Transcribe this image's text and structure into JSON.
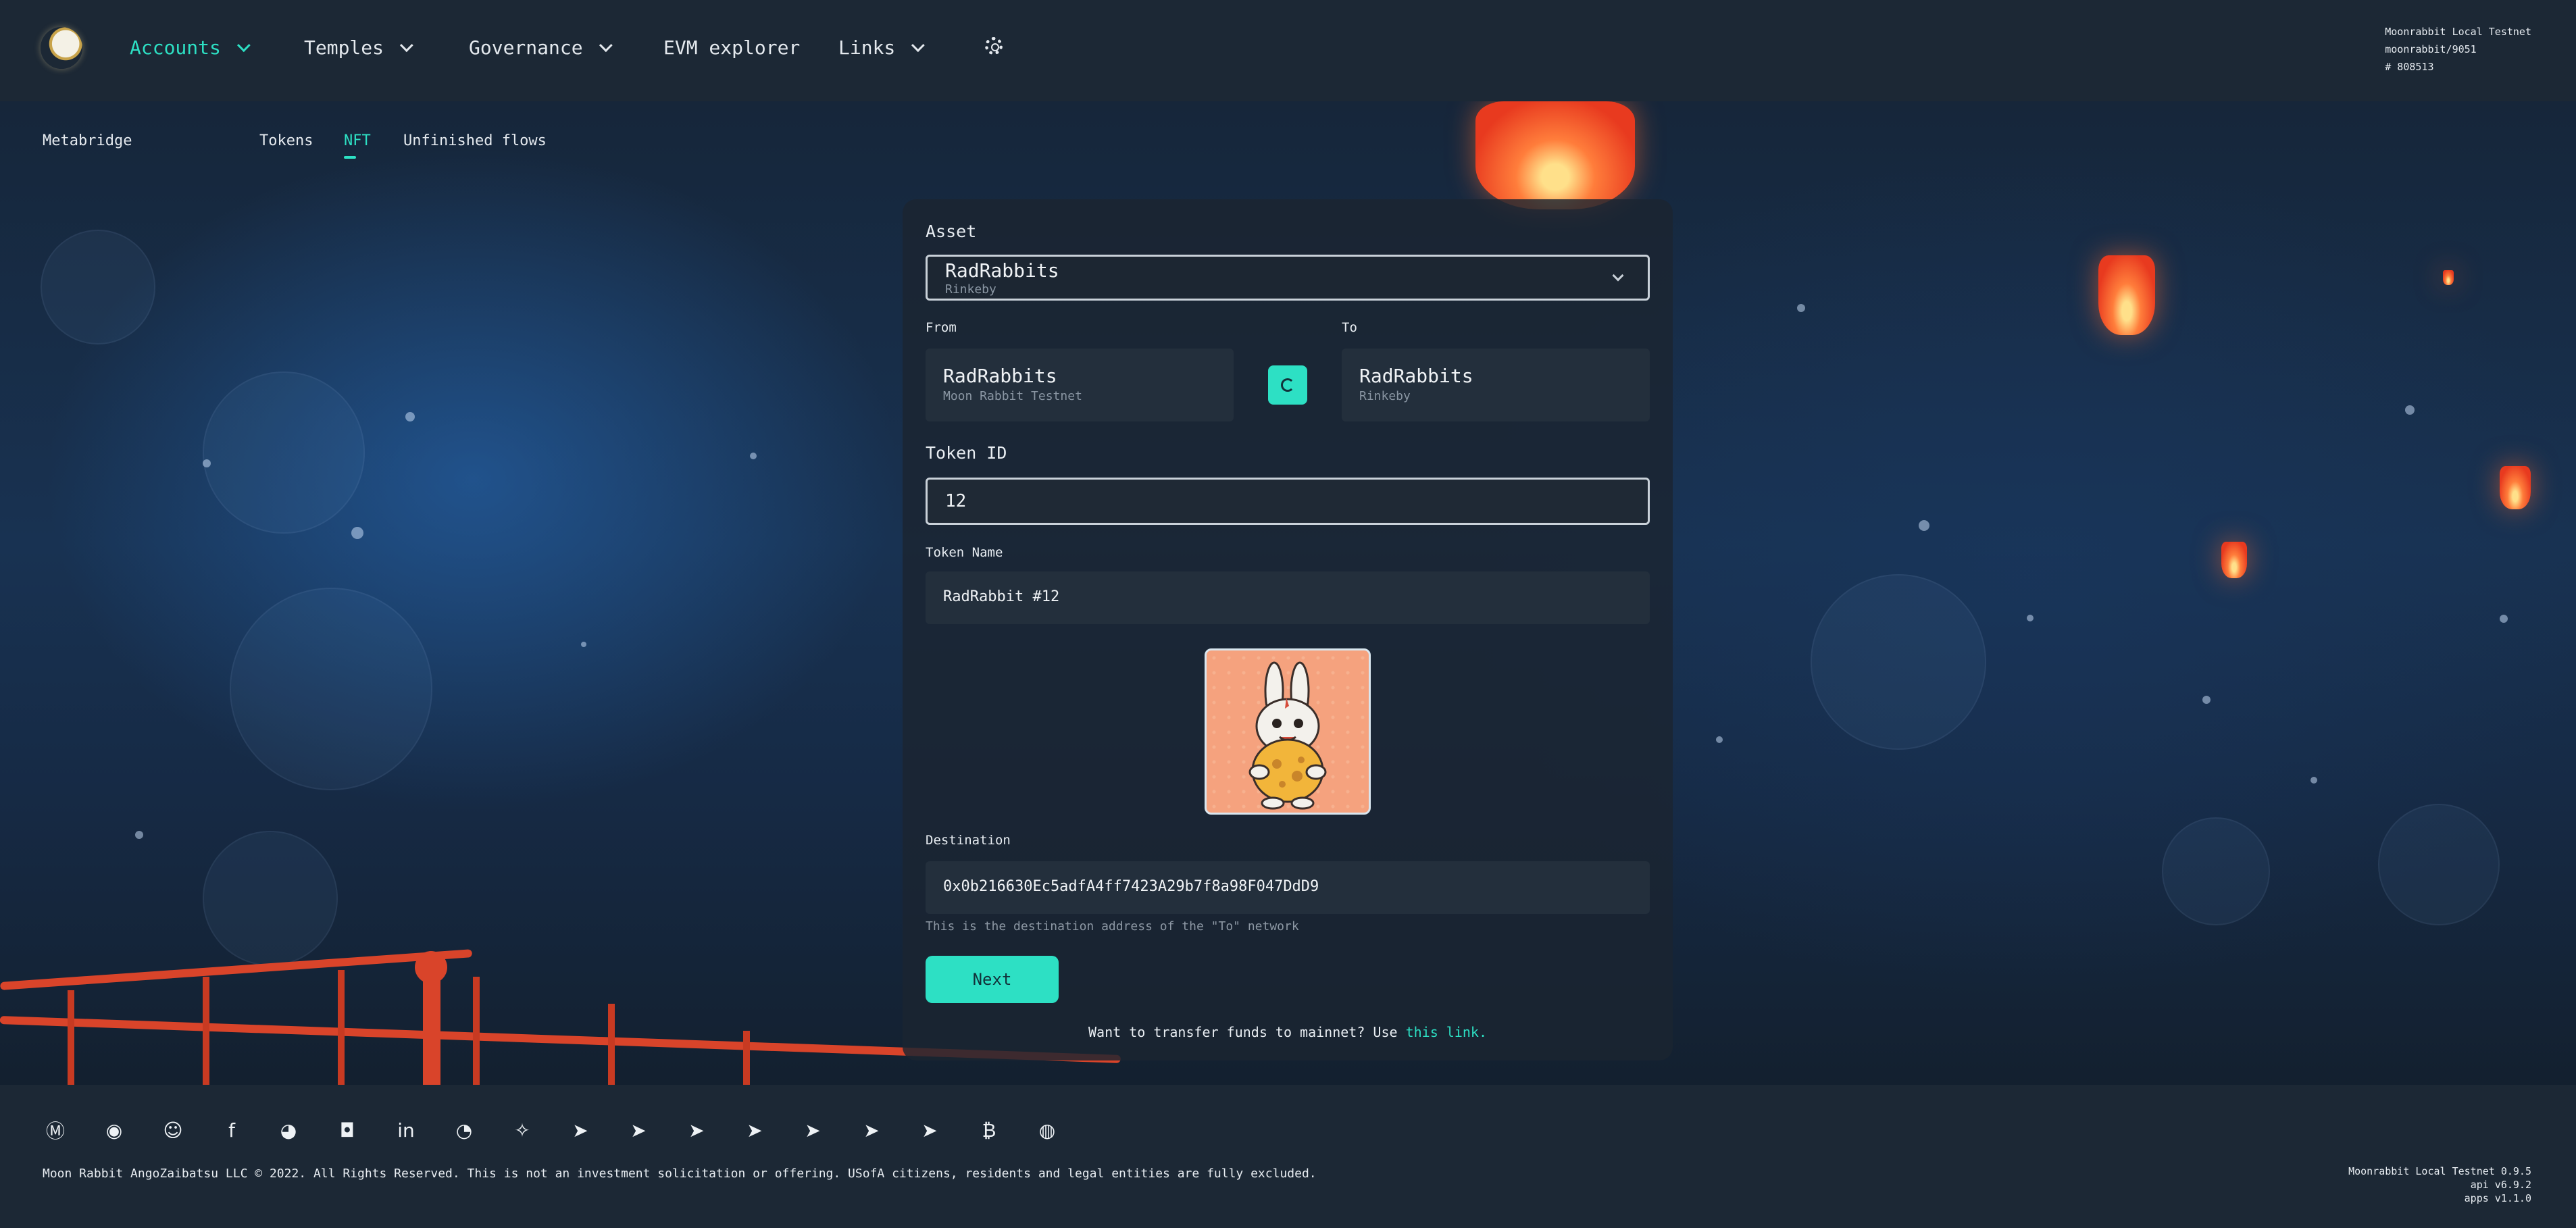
{
  "header": {
    "nav": [
      {
        "label": "Accounts",
        "has_dropdown": true,
        "active": true
      },
      {
        "label": "Temples",
        "has_dropdown": true
      },
      {
        "label": "Governance",
        "has_dropdown": true
      },
      {
        "label": "EVM explorer",
        "has_dropdown": false
      },
      {
        "label": "Links",
        "has_dropdown": true
      }
    ],
    "settings_icon": "gear-icon",
    "network": {
      "name": "Moonrabbit Local Testnet",
      "spec": "moonrabbit/9051",
      "block": "# 808513"
    }
  },
  "subnav": {
    "section": "Metabridge",
    "tabs": [
      {
        "label": "Tokens"
      },
      {
        "label": "NFT",
        "active": true
      },
      {
        "label": "Unfinished flows"
      }
    ]
  },
  "form": {
    "asset_label": "Asset",
    "asset_value": "RadRabbits",
    "asset_network": "Rinkeby",
    "from_label": "From",
    "from_name": "RadRabbits",
    "from_network": "Moon Rabbit Testnet",
    "to_label": "To",
    "to_name": "RadRabbits",
    "to_network": "Rinkeby",
    "token_id_label": "Token ID",
    "token_id_value": "12",
    "token_name_label": "Token Name",
    "token_name_value": "RadRabbit #12",
    "destination_label": "Destination",
    "destination_value": "0x0b216630Ec5adfA4ff7423A29b7f8a98F047DdD9",
    "destination_help": "This is the destination address of the \"To\" network",
    "next_label": "Next",
    "hint_text": "Want to transfer funds to mainnet? Use",
    "hint_link": "this link."
  },
  "footer": {
    "social_icons": [
      "coinmarketcap-icon",
      "coingecko-icon",
      "discord-icon",
      "facebook-icon",
      "github-icon",
      "instagram-icon",
      "linkedin-icon",
      "reddit-icon",
      "twitter-icon",
      "telegram-icon",
      "telegram-jp-icon",
      "telegram-kr-icon",
      "telegram-ru-icon",
      "telegram-cn-icon",
      "telegram-tr-icon",
      "telegram-en-icon",
      "bitcoin-icon",
      "weibo-icon"
    ],
    "copyright": "Moon Rabbit AngoZaibatsu LLC © 2022. All Rights Reserved. This is not an investment solicitation or offering. USofA citizens, residents and legal entities are fully excluded.",
    "versions": {
      "node": "Moonrabbit Local Testnet 0.9.5",
      "api": "api v6.9.2",
      "apps": "apps v1.1.0"
    }
  },
  "colors": {
    "accent": "#2de0c4",
    "nav_bg": "#1c2835",
    "card_bg": "#1b2531"
  }
}
